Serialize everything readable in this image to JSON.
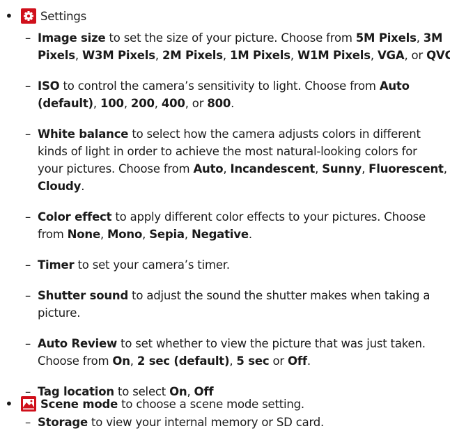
{
  "header": {
    "settings_label": "Settings"
  },
  "settings_items": [
    {
      "term": "Image size",
      "lines": [
        [
          {
            "t": "Image size",
            "b": true
          },
          {
            "t": " to set the size of your picture. Choose from "
          },
          {
            "t": "5M Pixels",
            "b": true
          },
          {
            "t": ", "
          },
          {
            "t": "3M",
            "b": true
          }
        ],
        [
          {
            "t": "Pixels",
            "b": true
          },
          {
            "t": ", "
          },
          {
            "t": "W3M Pixels",
            "b": true
          },
          {
            "t": ", "
          },
          {
            "t": "2M Pixels",
            "b": true
          },
          {
            "t": ", "
          },
          {
            "t": "1M Pixels",
            "b": true
          },
          {
            "t": ", "
          },
          {
            "t": "W1M Pixels",
            "b": true
          },
          {
            "t": ", "
          },
          {
            "t": "VGA",
            "b": true
          },
          {
            "t": ", or "
          },
          {
            "t": "QVGA",
            "b": true
          },
          {
            "t": "."
          }
        ]
      ]
    },
    {
      "term": "ISO",
      "lines": [
        [
          {
            "t": "ISO",
            "b": true
          },
          {
            "t": " to control the camera’s sensitivity to light. Choose from "
          },
          {
            "t": "Auto",
            "b": true
          }
        ],
        [
          {
            "t": "(default)",
            "b": true
          },
          {
            "t": ", "
          },
          {
            "t": "100",
            "b": true
          },
          {
            "t": ", "
          },
          {
            "t": "200",
            "b": true
          },
          {
            "t": ", "
          },
          {
            "t": "400",
            "b": true
          },
          {
            "t": ", or "
          },
          {
            "t": "800",
            "b": true
          },
          {
            "t": "."
          }
        ]
      ]
    },
    {
      "term": "White balance",
      "lines": [
        [
          {
            "t": "White balance",
            "b": true
          },
          {
            "t": " to select how the camera adjusts colors in different"
          }
        ],
        [
          {
            "t": "kinds of light in order to achieve the most natural-looking colors for"
          }
        ],
        [
          {
            "t": "your pictures. Choose from "
          },
          {
            "t": "Auto",
            "b": true
          },
          {
            "t": ", "
          },
          {
            "t": "Incandescent",
            "b": true
          },
          {
            "t": ", "
          },
          {
            "t": "Sunny",
            "b": true
          },
          {
            "t": ", "
          },
          {
            "t": "Fluorescent",
            "b": true
          },
          {
            "t": ", or"
          }
        ],
        [
          {
            "t": "Cloudy",
            "b": true
          },
          {
            "t": "."
          }
        ]
      ]
    },
    {
      "term": "Color effect",
      "lines": [
        [
          {
            "t": "Color effect",
            "b": true
          },
          {
            "t": " to apply different color effects to your pictures. Choose"
          }
        ],
        [
          {
            "t": "from "
          },
          {
            "t": "None",
            "b": true
          },
          {
            "t": ", "
          },
          {
            "t": "Mono",
            "b": true
          },
          {
            "t": ", "
          },
          {
            "t": "Sepia",
            "b": true
          },
          {
            "t": ", "
          },
          {
            "t": "Negative",
            "b": true
          },
          {
            "t": "."
          }
        ]
      ]
    },
    {
      "term": "Timer",
      "lines": [
        [
          {
            "t": "Timer",
            "b": true
          },
          {
            "t": " to set your camera’s timer."
          }
        ]
      ]
    },
    {
      "term": "Shutter sound",
      "lines": [
        [
          {
            "t": "Shutter sound",
            "b": true
          },
          {
            "t": " to adjust the sound the shutter makes when taking a"
          }
        ],
        [
          {
            "t": "picture."
          }
        ]
      ]
    },
    {
      "term": "Auto Review",
      "lines": [
        [
          {
            "t": "Auto Review",
            "b": true
          },
          {
            "t": " to set whether to view the picture that was just taken."
          }
        ],
        [
          {
            "t": "Choose from "
          },
          {
            "t": "On",
            "b": true
          },
          {
            "t": ", "
          },
          {
            "t": "2 sec (default)",
            "b": true
          },
          {
            "t": ", "
          },
          {
            "t": "5 sec",
            "b": true
          },
          {
            "t": " or "
          },
          {
            "t": "Off",
            "b": true
          },
          {
            "t": "."
          }
        ]
      ]
    },
    {
      "term": "Tag location",
      "lines": [
        [
          {
            "t": "Tag location",
            "b": true
          },
          {
            "t": " to select "
          },
          {
            "t": "On",
            "b": true
          },
          {
            "t": ", "
          },
          {
            "t": "Off",
            "b": true
          }
        ]
      ]
    },
    {
      "term": "Storage",
      "lines": [
        [
          {
            "t": "Storage",
            "b": true
          },
          {
            "t": " to view your internal memory or SD card."
          }
        ]
      ]
    }
  ],
  "scene_mode": {
    "label": "Scene mode",
    "rest": " to choose a scene mode setting."
  },
  "icons": {
    "settings": "gear-icon",
    "scene_mode": "landscape-icon",
    "icon_color": "#d0101b"
  }
}
